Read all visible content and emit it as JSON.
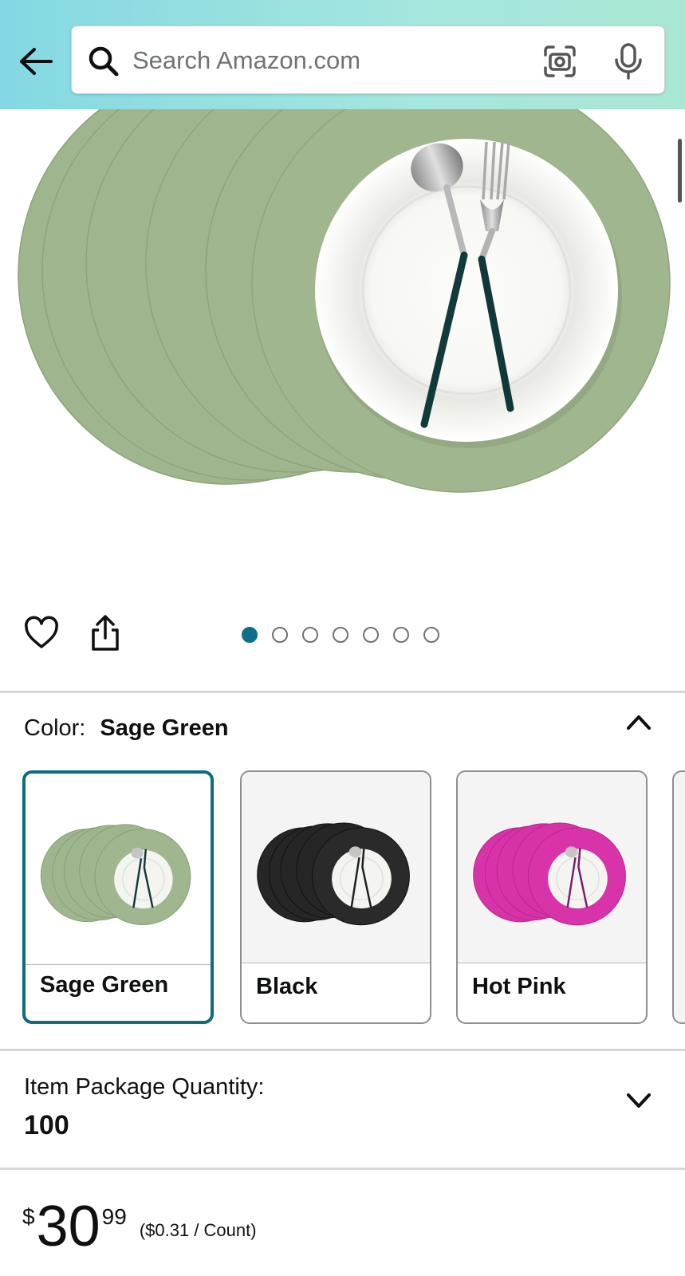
{
  "search": {
    "placeholder": "Search Amazon.com"
  },
  "gallery": {
    "dots_total": 7,
    "active_index": 0
  },
  "color": {
    "label": "Color:",
    "selected": "Sage Green",
    "options": [
      {
        "name": "Sage Green",
        "swatch_color": "#9fb38c"
      },
      {
        "name": "Black",
        "swatch_color": "#262626"
      },
      {
        "name": "Hot Pink",
        "swatch_color": "#d832a8"
      }
    ]
  },
  "quantity": {
    "label": "Item Package Quantity:",
    "value": "100"
  },
  "price": {
    "currency": "$",
    "whole": "30",
    "fraction": "99",
    "unit_price": "($0.31 / Count)"
  },
  "colors": {
    "accent": "#0f6b7e",
    "header_start": "#84d8e3",
    "header_end": "#a9e7d4",
    "active_dot": "#0f7189"
  }
}
